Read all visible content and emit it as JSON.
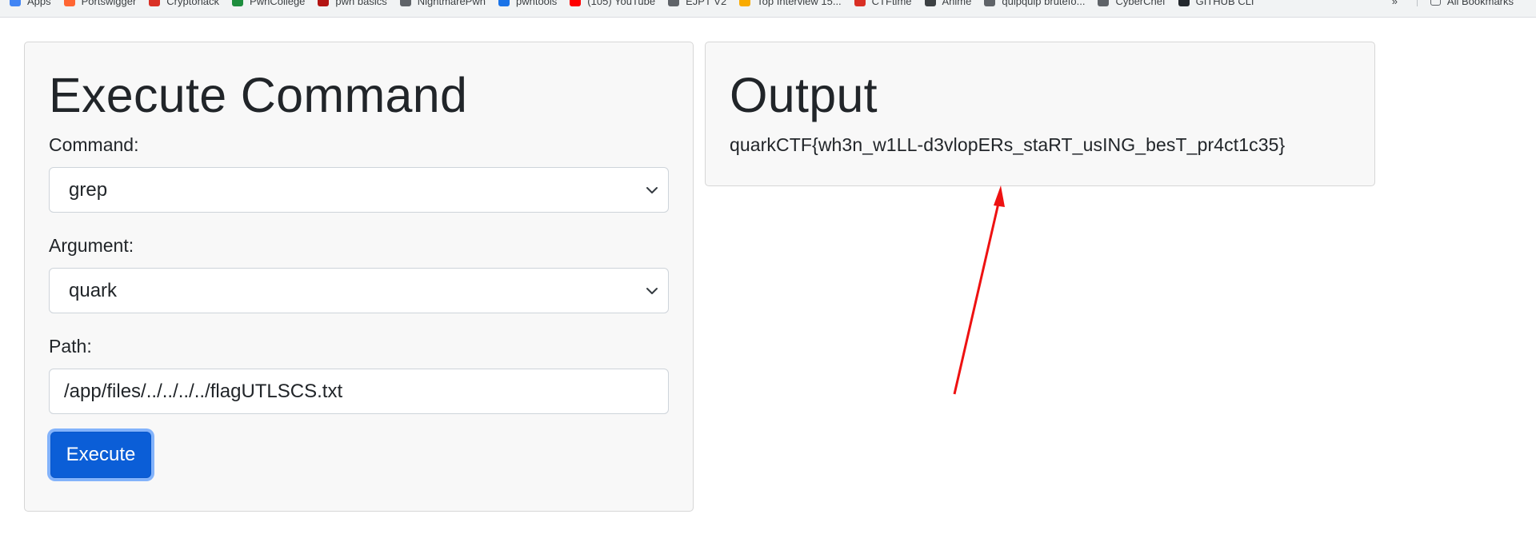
{
  "bookmarks": [
    {
      "label": "Apps",
      "icon": "apps-grid-icon",
      "color": "#4285f4"
    },
    {
      "label": "Portswigger",
      "icon": "portswigger-icon",
      "color": "#ff6633"
    },
    {
      "label": "Cryptohack",
      "icon": "cryptohack-icon",
      "color": "#d93025"
    },
    {
      "label": "PwnCollege",
      "icon": "pwncollege-icon",
      "color": "#1e8e3e"
    },
    {
      "label": "pwn basics",
      "icon": "pwn-basics-icon",
      "color": "#b31412"
    },
    {
      "label": "NightmarePwn",
      "icon": "nightmarepwn-icon",
      "color": "#5f6368"
    },
    {
      "label": "pwntools",
      "icon": "pwntools-icon",
      "color": "#1a73e8"
    },
    {
      "label": "(105) YouTube",
      "icon": "youtube-icon",
      "color": "#ff0000"
    },
    {
      "label": "EJPT V2",
      "icon": "globe-icon",
      "color": "#5f6368"
    },
    {
      "label": "Top Interview 15...",
      "icon": "leetcode-icon",
      "color": "#f9ab00"
    },
    {
      "label": "CTFtime",
      "icon": "ctftime-icon",
      "color": "#d93025"
    },
    {
      "label": "Anime",
      "icon": "anime-icon",
      "color": "#3c4043"
    },
    {
      "label": "quipquip brutefo...",
      "icon": "quipquip-icon",
      "color": "#5f6368"
    },
    {
      "label": "CyberChef",
      "icon": "cyberchef-icon",
      "color": "#5f6368"
    },
    {
      "label": "GITHUB CLI",
      "icon": "github-icon",
      "color": "#24292e"
    }
  ],
  "bookmarks_more": "»",
  "all_bookmarks": "All Bookmarks",
  "execute_card": {
    "title": "Execute Command",
    "command_label": "Command:",
    "command_value": "grep",
    "argument_label": "Argument:",
    "argument_value": "quark",
    "path_label": "Path:",
    "path_value": "/app/files/../../../../flagUTLSCS.txt",
    "execute_button": "Execute"
  },
  "output_card": {
    "title": "Output",
    "text": "quarkCTF{wh3n_w1LL-d3vlopERs_staRT_usING_besT_pr4ct1c35}"
  },
  "colors": {
    "button": "#0b5ed7",
    "arrow": "#ee1111",
    "card_bg": "#f8f8f8"
  }
}
